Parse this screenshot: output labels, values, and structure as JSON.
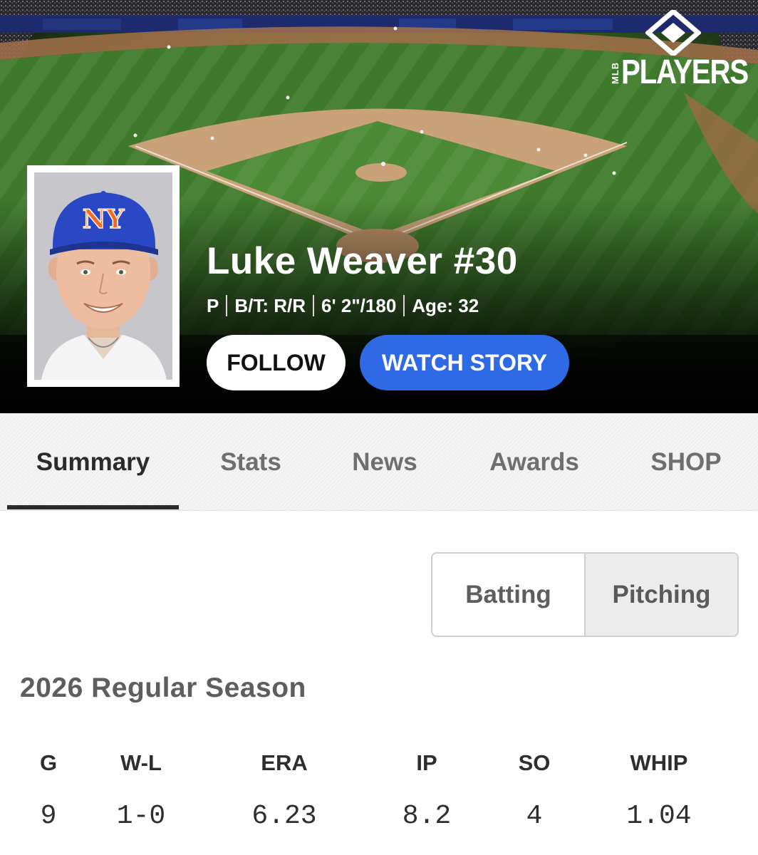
{
  "brand": {
    "wordmark": "PLAYERS",
    "league": "MLB"
  },
  "player": {
    "name": "Luke Weaver #30",
    "position": "P",
    "bats_throws": "B/T: R/R",
    "height_weight": "6' 2\"/180",
    "age": "Age: 32",
    "cap_logo": "NY"
  },
  "actions": {
    "follow_label": "FOLLOW",
    "watch_story_label": "WATCH STORY"
  },
  "tabs": [
    {
      "label": "Summary",
      "active": true
    },
    {
      "label": "Stats",
      "active": false
    },
    {
      "label": "News",
      "active": false
    },
    {
      "label": "Awards",
      "active": false
    },
    {
      "label": "SHOP",
      "active": false
    }
  ],
  "stat_type_toggle": {
    "options": [
      "Batting",
      "Pitching"
    ],
    "selected": "Pitching"
  },
  "season": {
    "title": "2026 Regular Season",
    "columns": [
      {
        "header": "G",
        "value": "9"
      },
      {
        "header": "W-L",
        "value": "1-0"
      },
      {
        "header": "ERA",
        "value": "6.23"
      },
      {
        "header": "IP",
        "value": "8.2"
      },
      {
        "header": "SO",
        "value": "4"
      },
      {
        "header": "WHIP",
        "value": "1.04"
      }
    ]
  },
  "colors": {
    "follow_bg": "#ffffff",
    "watch_story_bg": "#2f6ae6",
    "cap_blue": "#2b48c4",
    "cap_orange": "#f26b21",
    "field_green": "#3b7328",
    "infield_dirt": "#c9a27a"
  },
  "icons": [
    "mlb-players-logo-icon",
    "ny-cap-logo-icon"
  ]
}
